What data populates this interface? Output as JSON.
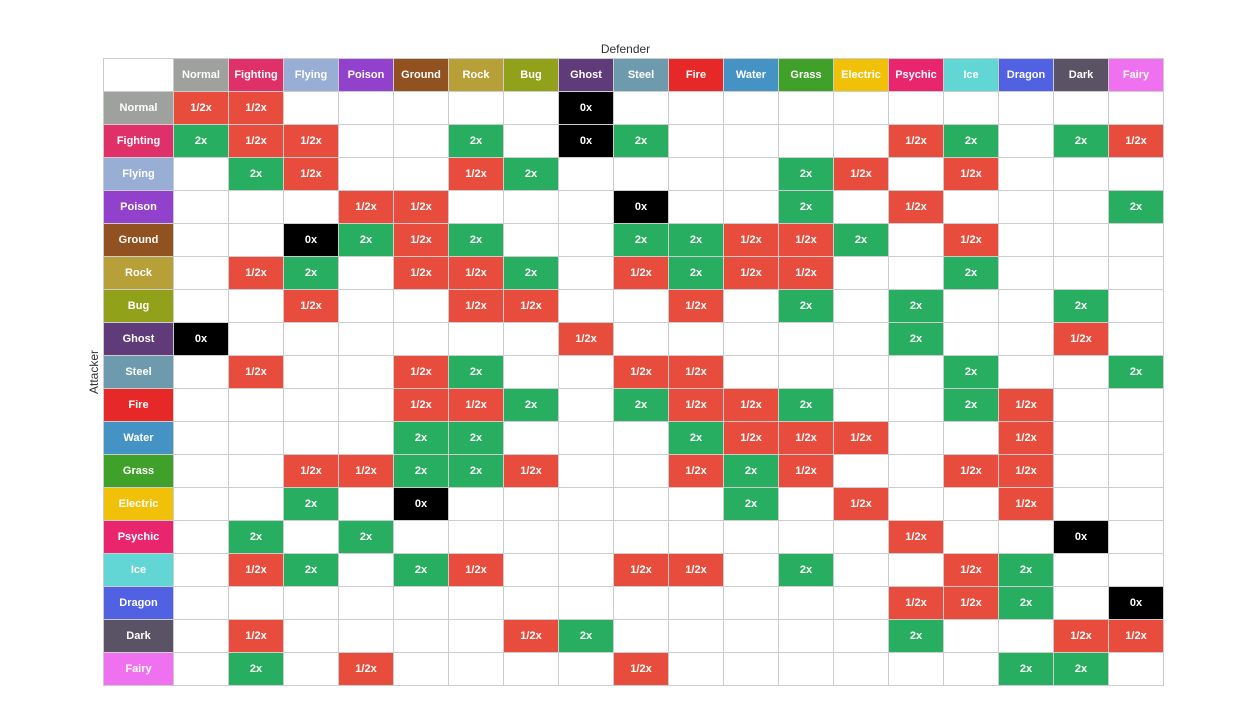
{
  "title": "Defender",
  "attacker_label": "Attacker",
  "types": [
    "Normal",
    "Fighting",
    "Flying",
    "Poison",
    "Ground",
    "Rock",
    "Bug",
    "Ghost",
    "Steel",
    "Fire",
    "Water",
    "Grass",
    "Electric",
    "Psychic",
    "Ice",
    "Dragon",
    "Dark",
    "Fairy"
  ],
  "table_data": {
    "Normal": {
      "Normal": "1/2x",
      "Fighting": "1/2x",
      "Flying": "",
      "Poison": "",
      "Ground": "",
      "Rock": "",
      "Bug": "",
      "Ghost": "0x",
      "Steel": "",
      "Fire": "",
      "Water": "",
      "Grass": "",
      "Electric": "",
      "Psychic": "",
      "Ice": "",
      "Dragon": "",
      "Dark": "",
      "Fairy": ""
    },
    "Fighting": {
      "Normal": "2x",
      "Fighting": "1/2x",
      "Flying": "1/2x",
      "Poison": "",
      "Ground": "",
      "Rock": "2x",
      "Bug": "",
      "Ghost": "0x",
      "Steel": "2x",
      "Fire": "",
      "Water": "",
      "Grass": "",
      "Electric": "",
      "Psychic": "1/2x",
      "Ice": "2x",
      "Dragon": "",
      "Dark": "2x",
      "Fairy": "1/2x"
    },
    "Flying": {
      "Normal": "",
      "Fighting": "2x",
      "Flying": "1/2x",
      "Poison": "",
      "Ground": "",
      "Rock": "1/2x",
      "Bug": "2x",
      "Ghost": "",
      "Steel": "",
      "Fire": "",
      "Water": "",
      "Grass": "2x",
      "Electric": "1/2x",
      "Psychic": "",
      "Ice": "1/2x",
      "Dragon": "",
      "Dark": "",
      "Fairy": ""
    },
    "Poison": {
      "Normal": "",
      "Fighting": "",
      "Flying": "",
      "Poison": "1/2x",
      "Ground": "1/2x",
      "Rock": "",
      "Bug": "",
      "Ghost": "",
      "Steel": "0x",
      "Fire": "",
      "Water": "",
      "Grass": "2x",
      "Electric": "",
      "Psychic": "1/2x",
      "Ice": "",
      "Dragon": "",
      "Dark": "",
      "Fairy": "2x"
    },
    "Ground": {
      "Normal": "",
      "Fighting": "",
      "Flying": "0x",
      "Poison": "2x",
      "Ground": "1/2x",
      "Rock": "2x",
      "Bug": "",
      "Ghost": "",
      "Steel": "2x",
      "Fire": "2x",
      "Water": "1/2x",
      "Grass": "1/2x",
      "Electric": "2x",
      "Psychic": "",
      "Ice": "1/2x",
      "Dragon": "",
      "Dark": "",
      "Fairy": ""
    },
    "Rock": {
      "Normal": "",
      "Fighting": "1/2x",
      "Flying": "2x",
      "Poison": "",
      "Ground": "1/2x",
      "Rock": "1/2x",
      "Bug": "2x",
      "Ghost": "",
      "Steel": "1/2x",
      "Fire": "2x",
      "Water": "1/2x",
      "Grass": "1/2x",
      "Electric": "",
      "Psychic": "",
      "Ice": "2x",
      "Dragon": "",
      "Dark": "",
      "Fairy": ""
    },
    "Bug": {
      "Normal": "",
      "Fighting": "",
      "Flying": "1/2x",
      "Poison": "",
      "Ground": "",
      "Rock": "1/2x",
      "Bug": "1/2x",
      "Ghost": "",
      "Steel": "",
      "Fire": "1/2x",
      "Water": "",
      "Grass": "2x",
      "Electric": "",
      "Psychic": "2x",
      "Ice": "",
      "Dragon": "",
      "Dark": "2x",
      "Fairy": ""
    },
    "Ghost": {
      "Normal": "0x",
      "Fighting": "",
      "Flying": "",
      "Poison": "",
      "Ground": "",
      "Rock": "",
      "Bug": "",
      "Ghost": "1/2x",
      "Steel": "",
      "Fire": "",
      "Water": "",
      "Grass": "",
      "Electric": "",
      "Psychic": "2x",
      "Ice": "",
      "Dragon": "",
      "Dark": "1/2x",
      "Fairy": ""
    },
    "Steel": {
      "Normal": "",
      "Fighting": "1/2x",
      "Flying": "",
      "Poison": "",
      "Ground": "1/2x",
      "Rock": "2x",
      "Bug": "",
      "Ghost": "",
      "Steel": "1/2x",
      "Fire": "1/2x",
      "Water": "",
      "Grass": "",
      "Electric": "",
      "Psychic": "",
      "Ice": "2x",
      "Dragon": "",
      "Dark": "",
      "Fairy": "2x"
    },
    "Fire": {
      "Normal": "",
      "Fighting": "",
      "Flying": "",
      "Poison": "",
      "Ground": "1/2x",
      "Rock": "1/2x",
      "Bug": "2x",
      "Ghost": "",
      "Steel": "2x",
      "Fire": "1/2x",
      "Water": "1/2x",
      "Grass": "2x",
      "Electric": "",
      "Psychic": "",
      "Ice": "2x",
      "Dragon": "1/2x",
      "Dark": "",
      "Fairy": ""
    },
    "Water": {
      "Normal": "",
      "Fighting": "",
      "Flying": "",
      "Poison": "",
      "Ground": "2x",
      "Rock": "2x",
      "Bug": "",
      "Ghost": "",
      "Steel": "",
      "Fire": "2x",
      "Water": "1/2x",
      "Grass": "1/2x",
      "Electric": "1/2x",
      "Psychic": "",
      "Ice": "",
      "Dragon": "1/2x",
      "Dark": "",
      "Fairy": ""
    },
    "Grass": {
      "Normal": "",
      "Fighting": "",
      "Flying": "1/2x",
      "Poison": "1/2x",
      "Ground": "2x",
      "Rock": "2x",
      "Bug": "1/2x",
      "Ghost": "",
      "Steel": "",
      "Fire": "1/2x",
      "Water": "2x",
      "Grass": "1/2x",
      "Electric": "",
      "Psychic": "",
      "Ice": "1/2x",
      "Dragon": "1/2x",
      "Dark": "",
      "Fairy": ""
    },
    "Electric": {
      "Normal": "",
      "Fighting": "",
      "Flying": "2x",
      "Poison": "",
      "Ground": "0x",
      "Rock": "",
      "Bug": "",
      "Ghost": "",
      "Steel": "",
      "Fire": "",
      "Water": "2x",
      "Grass": "",
      "Electric": "1/2x",
      "Psychic": "",
      "Ice": "",
      "Dragon": "1/2x",
      "Dark": "",
      "Fairy": ""
    },
    "Psychic": {
      "Normal": "",
      "Fighting": "2x",
      "Flying": "",
      "Poison": "2x",
      "Ground": "",
      "Rock": "",
      "Bug": "",
      "Ghost": "",
      "Steel": "",
      "Fire": "",
      "Water": "",
      "Grass": "",
      "Electric": "",
      "Psychic": "1/2x",
      "Ice": "",
      "Dragon": "",
      "Dark": "0x",
      "Fairy": ""
    },
    "Ice": {
      "Normal": "",
      "Fighting": "1/2x",
      "Flying": "2x",
      "Poison": "",
      "Ground": "2x",
      "Rock": "1/2x",
      "Bug": "",
      "Ghost": "",
      "Steel": "1/2x",
      "Fire": "1/2x",
      "Water": "",
      "Grass": "2x",
      "Electric": "",
      "Psychic": "",
      "Ice": "1/2x",
      "Dragon": "2x",
      "Dark": "",
      "Fairy": ""
    },
    "Dragon": {
      "Normal": "",
      "Fighting": "",
      "Flying": "",
      "Poison": "",
      "Ground": "",
      "Rock": "",
      "Bug": "",
      "Ghost": "",
      "Steel": "",
      "Fire": "",
      "Water": "",
      "Grass": "",
      "Electric": "",
      "Psychic": "1/2x",
      "Ice": "1/2x",
      "Dragon": "2x",
      "Dark": "",
      "Fairy": "0x"
    },
    "Dark": {
      "Normal": "",
      "Fighting": "1/2x",
      "Flying": "",
      "Poison": "",
      "Ground": "",
      "Rock": "",
      "Bug": "1/2x",
      "Ghost": "2x",
      "Steel": "",
      "Fire": "",
      "Water": "",
      "Grass": "",
      "Electric": "",
      "Psychic": "2x",
      "Ice": "",
      "Dragon": "",
      "Dark": "1/2x",
      "Fairy": "1/2x"
    },
    "Fairy": {
      "Normal": "",
      "Fighting": "2x",
      "Flying": "",
      "Poison": "1/2x",
      "Ground": "",
      "Rock": "",
      "Bug": "",
      "Ghost": "",
      "Steel": "1/2x",
      "Fire": "",
      "Water": "",
      "Grass": "",
      "Electric": "",
      "Psychic": "",
      "Ice": "",
      "Dragon": "2x",
      "Dark": "2x",
      "Fairy": ""
    }
  }
}
